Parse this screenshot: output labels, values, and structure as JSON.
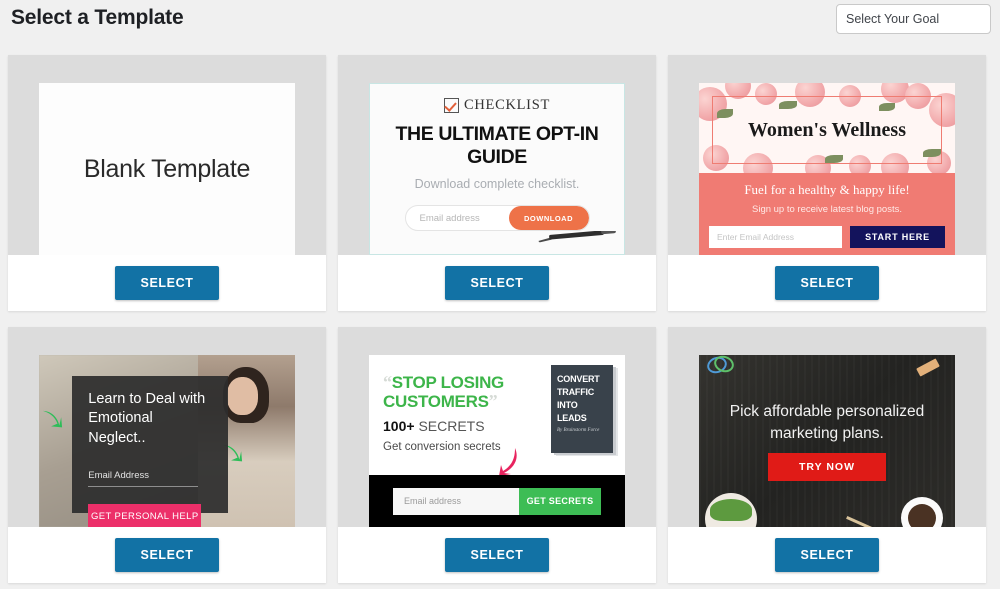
{
  "header": {
    "title": "Select a Template",
    "goal_select_value": "Select Your Goal",
    "goal_select_placeholder": "Select Your Goal"
  },
  "common": {
    "select_label": "SELECT",
    "accent_blue": "#1272a5",
    "page_bg": "#f0f0f0",
    "thumb_frame_bg": "#dcdcdc"
  },
  "templates": [
    {
      "id": "blank-template",
      "name": "Blank Template",
      "select_label": "SELECT",
      "content": {
        "heading": "Blank Template"
      }
    },
    {
      "id": "ultimate-opt-in-guide",
      "name": "The Ultimate Opt-In Guide",
      "select_label": "SELECT",
      "content": {
        "badge": "CHECKLIST",
        "heading": "THE ULTIMATE OPT-IN GUIDE",
        "subheading": "Download complete checklist.",
        "email_placeholder": "Email address",
        "cta": "DOWNLOAD",
        "cta_color": "#ee7248"
      }
    },
    {
      "id": "womens-wellness",
      "name": "Women's Wellness",
      "select_label": "SELECT",
      "content": {
        "heading": "Women's Wellness",
        "tagline": "Fuel for a healthy & happy life!",
        "subheading": "Sign up to receive latest blog posts.",
        "email_placeholder": "Enter Email Address",
        "cta": "START HERE",
        "cta_color": "#13135c",
        "band_color": "#f07b73"
      }
    },
    {
      "id": "emotional-neglect",
      "name": "Learn to Deal with Emotional Neglect",
      "select_label": "SELECT",
      "content": {
        "heading": "Learn to Deal with Emotional Neglect..",
        "email_placeholder": "Email Address",
        "cta": "GET PERSONAL HELP",
        "cta_color": "#ec2f69"
      }
    },
    {
      "id": "stop-losing-customers",
      "name": "Stop Losing Customers",
      "select_label": "SELECT",
      "content": {
        "quote_open": "“",
        "quote_close": "”",
        "heading_line1": "STOP LOSING",
        "heading_line2": "CUSTOMERS",
        "heading_color": "#3db54a",
        "secrets_count": "100+",
        "secrets_word": "SECRETS",
        "subheading": "Get conversion secrets",
        "book_line1": "CONVERT",
        "book_line2": "TRAFFIC",
        "book_line3": "INTO",
        "book_line4": "LEADS",
        "book_author": "By Brainstorm Force",
        "email_placeholder": "Email address",
        "cta": "GET SECRETS",
        "cta_color": "#3dbd55"
      }
    },
    {
      "id": "marketing-plans",
      "name": "Pick affordable personalized marketing plans",
      "select_label": "SELECT",
      "content": {
        "heading": "Pick affordable personalized marketing plans.",
        "cta": "TRY NOW",
        "cta_color": "#e01b17"
      }
    }
  ]
}
